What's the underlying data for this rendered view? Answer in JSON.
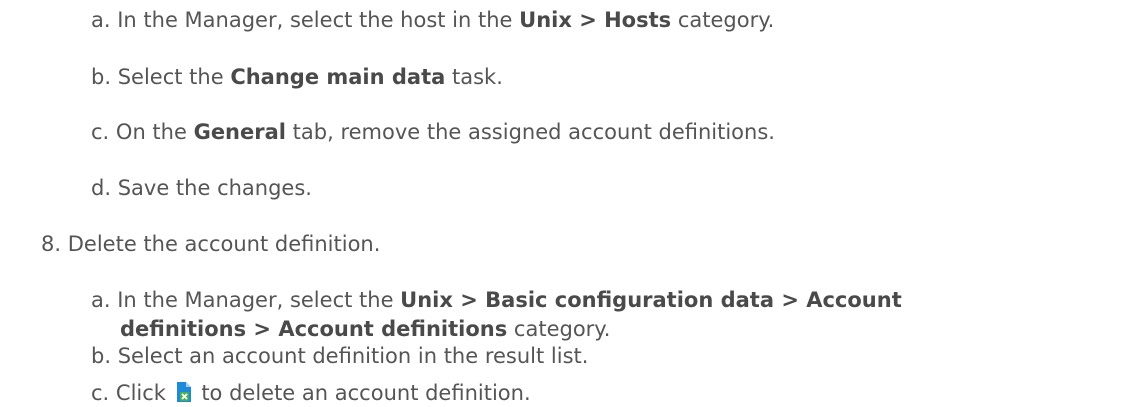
{
  "steps": {
    "sub_a1": {
      "marker": "a.",
      "pre": "In the Manager, select the host in the ",
      "bold": "Unix > Hosts",
      "post": " category."
    },
    "sub_b1": {
      "marker": "b.",
      "pre": "Select the ",
      "bold": "Change main data",
      "post": " task."
    },
    "sub_c1": {
      "marker": "c.",
      "pre": "On the ",
      "bold": "General",
      "post": " tab, remove the assigned account definitions."
    },
    "sub_d1": {
      "marker": "d.",
      "text": "Save the changes."
    },
    "step_8": {
      "marker": "8.",
      "text": "Delete the account definition."
    },
    "sub_a2": {
      "marker": "a.",
      "pre": "In the Manager, select the ",
      "bold1": "Unix > Basic configuration data > Account",
      "bold2": "definitions > Account definitions",
      "post": " category."
    },
    "sub_b2": {
      "marker": "b.",
      "text": "Select an account definition in the result list."
    },
    "sub_c2": {
      "marker": "c.",
      "pre": "Click ",
      "icon": "delete-document-icon",
      "post": " to delete an account definition."
    }
  },
  "colors": {
    "text": "#555555",
    "icon_blue": "#1e88d9",
    "icon_green": "#4caf50"
  }
}
